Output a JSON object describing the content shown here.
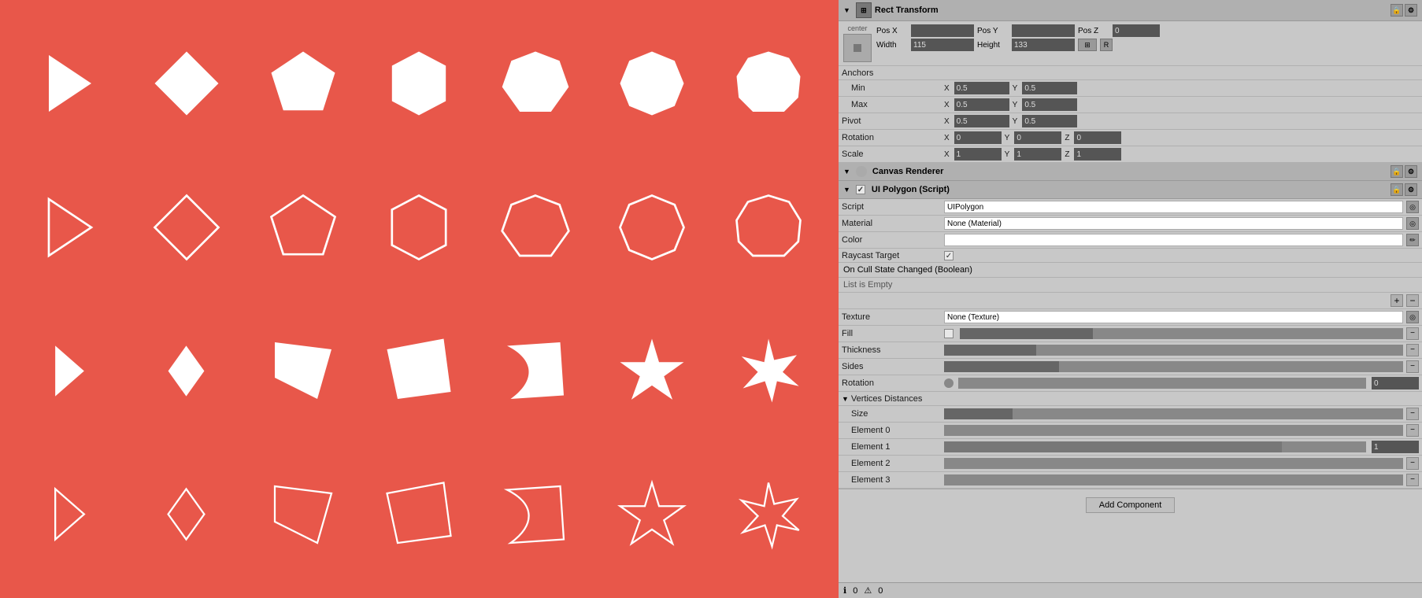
{
  "canvas": {
    "background_color": "#e8574a",
    "rows": [
      {
        "id": "row1",
        "shapes": [
          {
            "type": "triangle-left",
            "filled": true,
            "outline": false
          },
          {
            "type": "diamond",
            "filled": true,
            "outline": false
          },
          {
            "type": "pentagon",
            "filled": true,
            "outline": false
          },
          {
            "type": "hexagon",
            "filled": true,
            "outline": false
          },
          {
            "type": "heptagon",
            "filled": true,
            "outline": false
          },
          {
            "type": "octagon",
            "filled": true,
            "outline": false
          },
          {
            "type": "nonagon",
            "filled": true,
            "outline": false
          }
        ]
      },
      {
        "id": "row2",
        "shapes": [
          {
            "type": "triangle-left",
            "filled": false,
            "outline": true
          },
          {
            "type": "diamond",
            "filled": false,
            "outline": true
          },
          {
            "type": "pentagon",
            "filled": false,
            "outline": true
          },
          {
            "type": "hexagon",
            "filled": false,
            "outline": true
          },
          {
            "type": "heptagon",
            "filled": false,
            "outline": true
          },
          {
            "type": "octagon",
            "filled": false,
            "outline": true
          },
          {
            "type": "nonagon",
            "filled": false,
            "outline": true
          }
        ]
      },
      {
        "id": "row3",
        "shapes": [
          {
            "type": "small-triangle",
            "filled": true,
            "outline": false
          },
          {
            "type": "small-diamond",
            "filled": true,
            "outline": false
          },
          {
            "type": "wedge1",
            "filled": true,
            "outline": false
          },
          {
            "type": "wedge2",
            "filled": true,
            "outline": false
          },
          {
            "type": "blob1",
            "filled": true,
            "outline": false
          },
          {
            "type": "star4",
            "filled": true,
            "outline": false
          },
          {
            "type": "star5",
            "filled": true,
            "outline": false
          }
        ]
      },
      {
        "id": "row4",
        "shapes": [
          {
            "type": "small-triangle",
            "filled": false,
            "outline": true
          },
          {
            "type": "small-diamond",
            "filled": false,
            "outline": true
          },
          {
            "type": "wedge1",
            "filled": false,
            "outline": true
          },
          {
            "type": "wedge2",
            "filled": false,
            "outline": true
          },
          {
            "type": "blob1",
            "filled": false,
            "outline": true
          },
          {
            "type": "star4",
            "filled": false,
            "outline": true
          },
          {
            "type": "star5",
            "filled": false,
            "outline": true
          }
        ]
      }
    ]
  },
  "inspector": {
    "rect_transform": {
      "label": "Rect Transform",
      "center_label": "center",
      "pos_x_label": "Pos X",
      "pos_y_label": "Pos Y",
      "pos_z_label": "Pos Z",
      "pos_x_val": "",
      "pos_y_val": "",
      "pos_z_val": "0",
      "width_label": "Width",
      "height_label": "Height",
      "width_val": "115",
      "height_val": "133",
      "anchors_label": "Anchors",
      "min_label": "Min",
      "max_label": "Max",
      "anchor_min_x": "0.5",
      "anchor_min_y": "0.5",
      "anchor_max_x": "0.5",
      "anchor_max_y": "0.5",
      "pivot_label": "Pivot",
      "pivot_x": "0.5",
      "pivot_y": "0.5",
      "rotation_label": "Rotation",
      "rot_x": "0",
      "rot_y": "0",
      "rot_z": "0",
      "scale_label": "Scale",
      "scale_x": "1",
      "scale_y": "1",
      "scale_z": "1"
    },
    "canvas_renderer": {
      "label": "Canvas Renderer"
    },
    "ui_polygon": {
      "label": "UI Polygon (Script)",
      "script_label": "Script",
      "script_val": "UIPolygon",
      "material_label": "Material",
      "material_val": "None (Material)",
      "color_label": "Color",
      "raycast_label": "Raycast Target",
      "on_cull_label": "On Cull State Changed (Boolean)",
      "list_empty_label": "List is Empty",
      "texture_label": "Texture",
      "texture_val": "None (Texture)",
      "fill_label": "Fill",
      "thickness_label": "Thickness",
      "sides_label": "Sides",
      "rotation_label": "Rotation",
      "rotation_val": "0",
      "vertices_label": "Vertices Distances",
      "size_label": "Size",
      "element_0": "Element 0",
      "element_1": "Element 1",
      "element_2": "Element 2",
      "element_3": "Element 3",
      "element_1_val": "1"
    },
    "add_component_label": "Add Component",
    "bottom_bar": {
      "info_val": "0",
      "warning_val": "0"
    }
  }
}
